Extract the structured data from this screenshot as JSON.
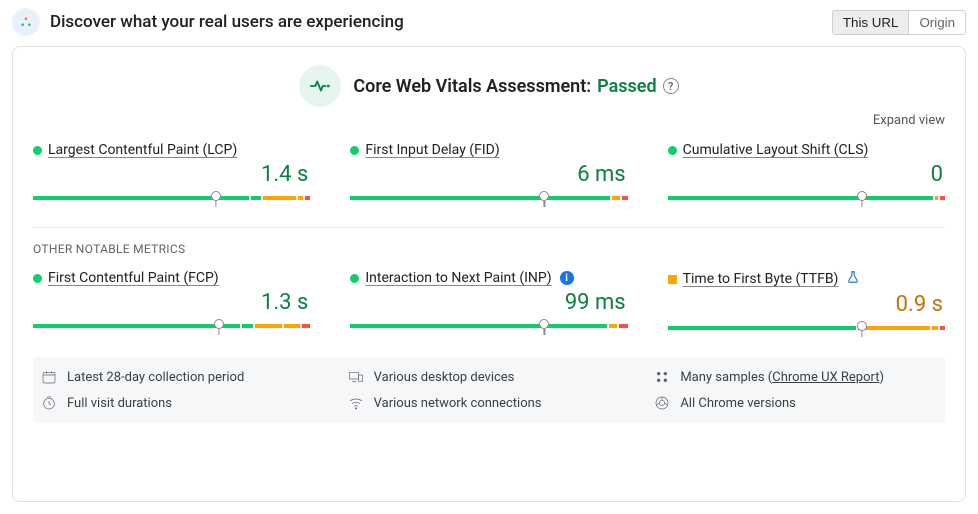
{
  "header": {
    "title": "Discover what your real users are experiencing",
    "toggle": {
      "this_url": "This URL",
      "origin": "Origin"
    }
  },
  "assessment": {
    "label": "Core Web Vitals Assessment:",
    "status": "Passed"
  },
  "expand_label": "Expand view",
  "core_metrics": [
    {
      "name": "Largest Contentful Paint (LCP)",
      "value": "1.4 s",
      "status": "green",
      "marker_pct": 66,
      "segments": [
        80,
        4,
        12,
        2,
        2
      ]
    },
    {
      "name": "First Input Delay (FID)",
      "value": "6 ms",
      "status": "green",
      "marker_pct": 70,
      "segments": [
        95,
        3,
        2
      ]
    },
    {
      "name": "Cumulative Layout Shift (CLS)",
      "value": "0",
      "status": "green",
      "marker_pct": 70,
      "segments": [
        97,
        1,
        2
      ]
    }
  ],
  "other_label": "OTHER NOTABLE METRICS",
  "other_metrics": [
    {
      "name": "First Contentful Paint (FCP)",
      "value": "1.3 s",
      "status": "green",
      "marker_pct": 67,
      "segments": [
        77,
        4,
        10,
        6,
        3
      ],
      "suffix": null
    },
    {
      "name": "Interaction to Next Paint (INP)",
      "value": "99 ms",
      "status": "green",
      "marker_pct": 70,
      "segments": [
        94,
        3,
        3
      ],
      "suffix": "info"
    },
    {
      "name": "Time to First Byte (TTFB)",
      "value": "0.9 s",
      "status": "orange",
      "marker_pct": 70,
      "segments": [
        70,
        1,
        25,
        2,
        2
      ],
      "suffix": "flask"
    }
  ],
  "info": {
    "period": "Latest 28-day collection period",
    "devices": "Various desktop devices",
    "samples_prefix": "Many samples (",
    "samples_link": "Chrome UX Report",
    "samples_suffix": ")",
    "durations": "Full visit durations",
    "network": "Various network connections",
    "versions": "All Chrome versions"
  }
}
